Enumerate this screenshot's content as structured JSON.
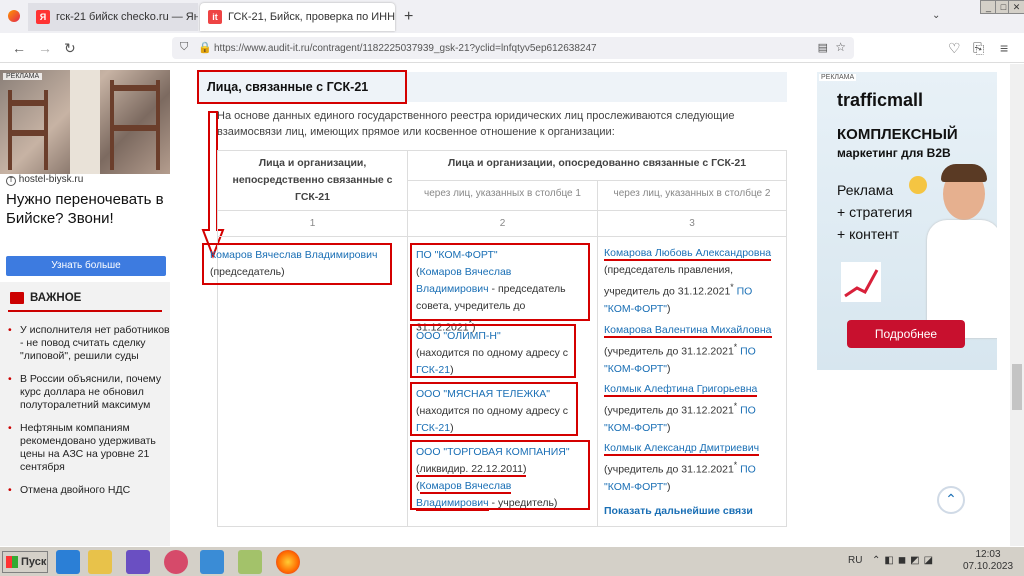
{
  "browser": {
    "tabs": [
      {
        "label": "гск-21 бийск checko.ru — Яндекс",
        "icon": "Я"
      },
      {
        "label": "ГСК-21, Бийск, проверка по ИНН",
        "icon": "it"
      }
    ],
    "url": "https://www.audit-it.ru/contragent/1182225037939_gsk-21?yclid=lnfqtyv5ep612638247"
  },
  "left_ad": {
    "badge": "РЕКЛАМА",
    "domain": "hostel-biysk.ru",
    "text": "Нужно переночевать в Бийске? Звони!",
    "button": "Узнать больше"
  },
  "news": {
    "title": "ВАЖНОЕ",
    "items": [
      "У исполнителя нет работников - не повод считать сделку \"липовой\", решили суды",
      "В России объяснили, почему курс доллара не обновил полуторалетний максимум",
      "Нефтяным компаниям рекомендовано удерживать цены на АЗС на уровне 21 сентября",
      "Отмена двойного НДС"
    ]
  },
  "section": {
    "title": "Лица, связанные с ГСК-21",
    "intro": "На основе данных единого государственного реестра юридических лиц прослеживаются следующие взаимосвязи лиц, имеющих прямое или косвенное отношение к организации:"
  },
  "table": {
    "col1_header": "Лица и организации, непосредственно связанные с ГСК-21",
    "col23_header": "Лица и организации, опосредованно связанные с ГСК-21",
    "col2_sub": "через лиц, указанных в столбце 1",
    "col3_sub": "через лиц, указанных в столбце 2",
    "nums": [
      "1",
      "2",
      "3"
    ],
    "col1": {
      "name": "Комаров Вячеслав Владимирович",
      "role": "(председатель)"
    },
    "col2": [
      {
        "org": "ПО \"КОМ-ФОРТ\"",
        "pre": "(",
        "link": "Комаров Вячеслав Владимирович",
        "post": " - председатель совета, учредитель до 31.12.2021",
        "sup": "*",
        "end": ")"
      },
      {
        "org": "ООО \"ОЛИМП-Н\"",
        "pre": "(находится по одному адресу с ",
        "link": "ГСК-21",
        "end": ")"
      },
      {
        "org": "ООО \"МЯСНАЯ ТЕЛЕЖКА\"",
        "pre": "(находится по одному адресу с ",
        "link": "ГСК-21",
        "end": ")"
      },
      {
        "org": "ООО \"ТОРГОВАЯ КОМПАНИЯ\"",
        "liq": "(ликвидир. 22.12.2011)",
        "pre": "(",
        "link": "Комаров Вячеслав Владимирович",
        "post": " - учредитель)"
      }
    ],
    "col3": [
      {
        "name": "Комарова Любовь Александровна",
        "text": "(председатель правления, учредитель до 31.12.2021",
        "sup": "*",
        "link": "ПО \"КОМ-ФОРТ\"",
        "end": ")"
      },
      {
        "name": "Комарова Валентина Михайловна",
        "text": "(учредитель до 31.12.2021",
        "sup": "*",
        "link": "ПО \"КОМ-ФОРТ\"",
        "end": ")"
      },
      {
        "name": "Колмык Алефтина Григорьевна",
        "text": "(учредитель до 31.12.2021",
        "sup": "*",
        "link": "ПО \"КОМ-ФОРТ\"",
        "end": ")"
      },
      {
        "name": "Колмык Александр Дмитриевич",
        "text": "(учредитель до 31.12.2021",
        "sup": "*",
        "link": "ПО \"КОМ-ФОРТ\"",
        "end": ")"
      }
    ],
    "more": "Показать дальнейшие связи"
  },
  "right_ad": {
    "badge": "РЕКЛАМА",
    "brand": "trafficmall",
    "line1": "КОМПЛЕКСНЫЙ",
    "line2": "маркетинг для B2B",
    "line3": "Реклама",
    "line4": "+ стратегия",
    "line5": "+ контент",
    "button": "Подробнее"
  },
  "taskbar": {
    "start": "Пуск",
    "lang": "RU",
    "time": "12:03",
    "date": "07.10.2023"
  },
  "colors": {
    "accent_red": "#d40000",
    "link": "#1a6fb5",
    "ad_button": "#c8102e",
    "news_red": "#c00"
  }
}
